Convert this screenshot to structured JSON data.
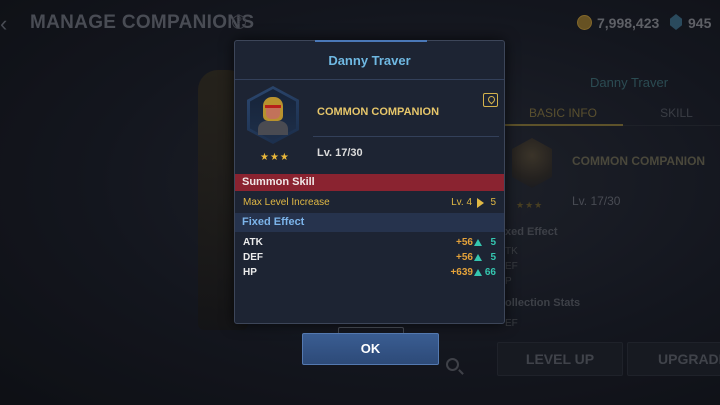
{
  "header": {
    "title": "MANAGE COMPANIONS",
    "gold": "7,998,423",
    "gems": "945"
  },
  "side_panel": {
    "name": "Danny Traver",
    "tabs": [
      "BASIC INFO",
      "SKILL"
    ],
    "rarity": "COMMON COMPANION",
    "level": "Lv. 17/30",
    "stars": "★★★",
    "fixed_effect": "xed Effect",
    "atk": "TK",
    "def": "EF",
    "hp": "P",
    "collection": "ollection Stats",
    "def2": "EF",
    "level_up": "LEVEL UP",
    "upgrade": "UPGRADE"
  },
  "dialog": {
    "title": "Danny Traver",
    "rarity": "COMMON COMPANION",
    "level": "Lv. 17/30",
    "stars": "★★★",
    "summon_skill_title": "Summon Skill",
    "skill_name": "Max Level Increase",
    "skill_from": "Lv. 4",
    "skill_to": "5",
    "fixed_effect_title": "Fixed Effect",
    "stats": [
      {
        "label": "ATK",
        "base": "+56",
        "inc": "5"
      },
      {
        "label": "DEF",
        "base": "+56",
        "inc": "5"
      },
      {
        "label": "HP",
        "base": "+639",
        "inc": "66"
      }
    ],
    "ok_label": "OK"
  },
  "colors": {
    "summon_bar": "#8a2330",
    "fixed_bar": "#26334d",
    "title_blue": "#6fb8e2",
    "gold_text": "#e0b845",
    "stat_increase": "#35c6b0"
  }
}
